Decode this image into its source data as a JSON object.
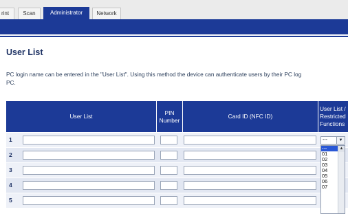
{
  "tabs": [
    {
      "label": "rint"
    },
    {
      "label": "Scan"
    },
    {
      "label": "Administrator",
      "active": true
    },
    {
      "label": "Network"
    }
  ],
  "page": {
    "title": "User List",
    "description_line1": "PC login name can be entered in the \"User List\". Using this method the device can authenticate users by their PC log",
    "description_line2": "PC."
  },
  "table": {
    "headers": {
      "user_list": "User List",
      "pin_line1": "PIN",
      "pin_line2": "Number",
      "card_id": "Card ID (NFC ID)",
      "restricted_line1": "User List /",
      "restricted_line2": "Restricted",
      "restricted_line3": "Functions"
    },
    "rows": [
      {
        "num": "1",
        "user": "",
        "pin": "",
        "card": ""
      },
      {
        "num": "2",
        "user": "",
        "pin": "",
        "card": ""
      },
      {
        "num": "3",
        "user": "",
        "pin": "",
        "card": ""
      },
      {
        "num": "4",
        "user": "",
        "pin": "",
        "card": ""
      },
      {
        "num": "5",
        "user": "",
        "pin": "",
        "card": ""
      }
    ],
    "restricted_select": {
      "value": "---",
      "options": [
        "---",
        "01",
        "02",
        "03",
        "04",
        "05",
        "06",
        "07"
      ],
      "selected_index": 0
    }
  },
  "colors": {
    "accent": "#1c3a97",
    "selected_option": "#2a58d6"
  }
}
